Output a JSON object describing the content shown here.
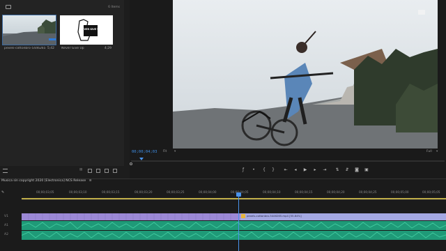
{
  "project": {
    "items_count": "6 Items",
    "clips": [
      {
        "name": "pexels-cottonbro-5446265.m...",
        "duration": "5;42"
      },
      {
        "name": "Never Give Up",
        "duration": "4;29"
      }
    ],
    "thumb_text": "NEVER GIVE UP"
  },
  "program": {
    "timecode": "00;00;04;03",
    "fit_label": "Fit",
    "resolution_label": "Full"
  },
  "timeline": {
    "sequence_name": "Musica sin copyright 2020 [Electronica] NCS Release",
    "ruler_labels": [
      "00;00;03;05",
      "00;00;03;10",
      "00;00;03;15",
      "00;00;03;20",
      "00;00;03;25",
      "00;00;04;00",
      "00;00;04;05",
      "00;00;04;10",
      "00;00;04;15",
      "00;00;04;20",
      "00;00;04;25",
      "00;00;05;00",
      "00;00;05;05"
    ],
    "clip_label": "pexels-cottonbro-5446265.mp4 [55.84%]"
  },
  "colors": {
    "accent_blue": "#3f8fe6",
    "audio_green": "#1f9a78",
    "clip_purple": "#9c89d6",
    "clip_lavender": "#a4a8e2"
  }
}
